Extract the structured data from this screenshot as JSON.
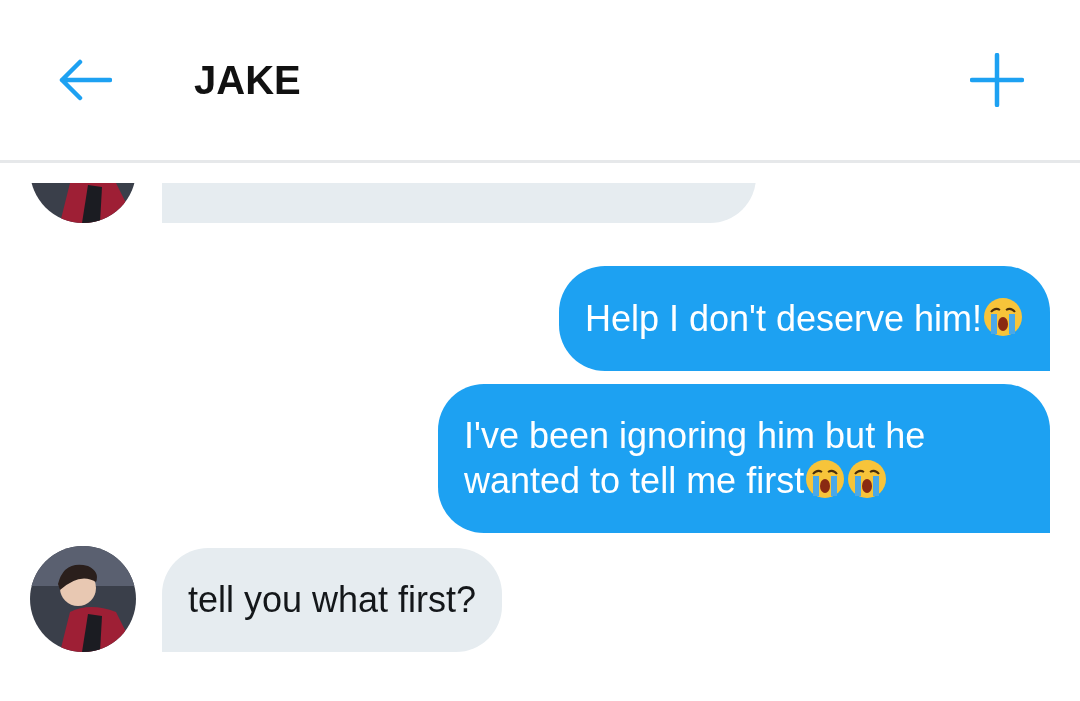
{
  "header": {
    "title": "JAKE"
  },
  "messages": [
    {
      "kind": "received",
      "cut_off": true
    },
    {
      "kind": "sent",
      "cut_off": false,
      "text": "Help I don't deserve him!",
      "icons": [
        {
          "kind": "crying"
        }
      ]
    },
    {
      "kind": "sent",
      "cut_off": false,
      "text": "I've been ignoring him but he wanted to tell me first",
      "icons": [
        {
          "kind": "crying"
        },
        {
          "kind": "crying"
        }
      ]
    },
    {
      "kind": "received",
      "cut_off": false,
      "text": "tell you what first?"
    }
  ]
}
